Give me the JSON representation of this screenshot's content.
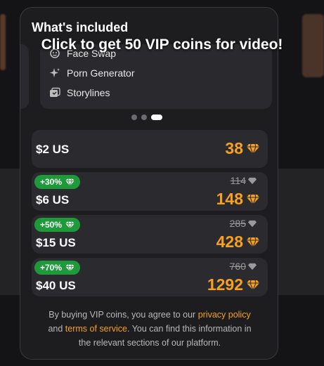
{
  "overlay": {
    "banner": "Click to get 50 VIP coins for video!"
  },
  "included": {
    "title": "What's included",
    "features": [
      {
        "label": "Face Swap",
        "icon": "face-swap-icon"
      },
      {
        "label": "Porn Generator",
        "icon": "sparkle-icon"
      },
      {
        "label": "Storylines",
        "icon": "storylines-icon"
      }
    ]
  },
  "carousel": {
    "pages": 3,
    "active_index": 2
  },
  "plans": [
    {
      "price": "$2 US",
      "coins": "38",
      "badge": "",
      "old_coins": ""
    },
    {
      "price": "$6 US",
      "coins": "148",
      "badge": "+30%",
      "old_coins": "114"
    },
    {
      "price": "$15 US",
      "coins": "428",
      "badge": "+50%",
      "old_coins": "285"
    },
    {
      "price": "$40 US",
      "coins": "1292",
      "badge": "+70%",
      "old_coins": "760"
    }
  ],
  "legal": {
    "text_1": "By buying VIP coins, you agree to our ",
    "link_privacy": "privacy policy",
    "text_2": " and ",
    "link_terms": "terms of service",
    "text_3": ". You can find this information in the relevant sections of our platform."
  },
  "colors": {
    "accent": "#f7a11e",
    "badge": "#1f9a3a",
    "card": "#2b2b2f"
  }
}
